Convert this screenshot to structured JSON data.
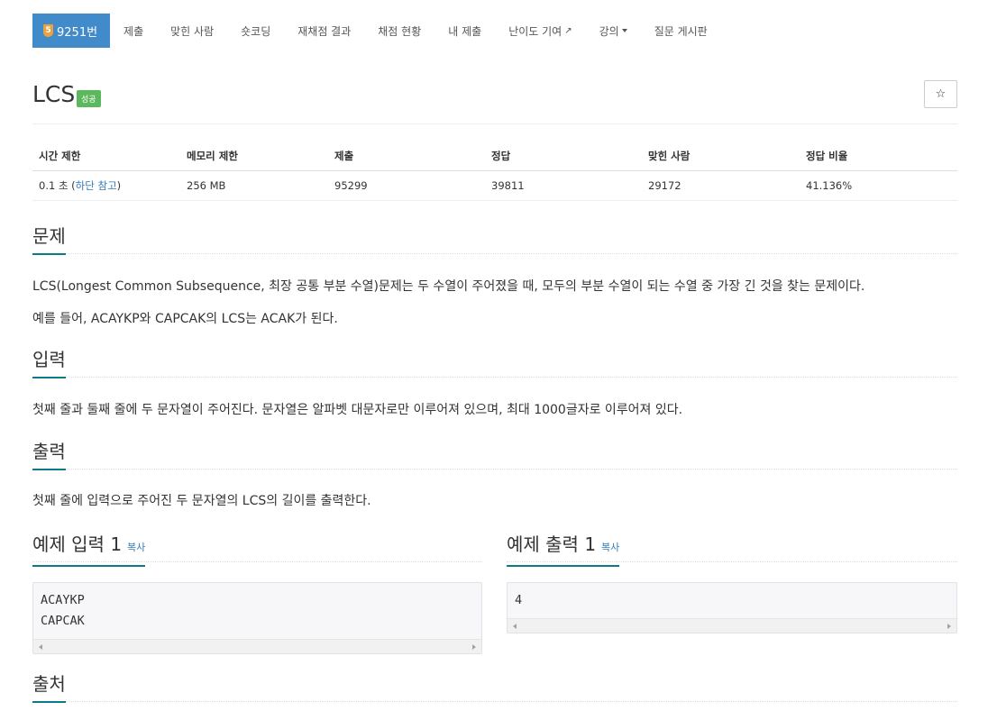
{
  "nav": {
    "problem_badge": "5",
    "problem_number": "9251번",
    "items": [
      "제출",
      "맞힌 사람",
      "숏코딩",
      "재채점 결과",
      "채점 현황",
      "내 제출",
      "난이도 기여",
      "강의",
      "질문 게시판"
    ]
  },
  "problem": {
    "title": "LCS",
    "status": "성공"
  },
  "info": {
    "headers": [
      "시간 제한",
      "메모리 제한",
      "제출",
      "정답",
      "맞힌 사람",
      "정답 비율"
    ],
    "time_limit_prefix": "0.1 초 (",
    "time_limit_link": "하단 참고",
    "time_limit_suffix": ")",
    "memory_limit": "256 MB",
    "submissions": "95299",
    "accepted": "39811",
    "solvers": "29172",
    "ratio": "41.136%"
  },
  "sections": {
    "description_title": "문제",
    "description_p1": "LCS(Longest Common Subsequence, 최장 공통 부분 수열)문제는 두 수열이 주어졌을 때, 모두의 부분 수열이 되는 수열 중 가장 긴 것을 찾는 문제이다.",
    "description_p2": "예를 들어, ACAYKP와 CAPCAK의 LCS는 ACAK가 된다.",
    "input_title": "입력",
    "input_text": "첫째 줄과 둘째 줄에 두 문자열이 주어진다. 문자열은 알파벳 대문자로만 이루어져 있으며, 최대 1000글자로 이루어져 있다.",
    "output_title": "출력",
    "output_text": "첫째 줄에 입력으로 주어진 두 문자열의 LCS의 길이를 출력한다.",
    "sample_input_title": "예제 입력 1",
    "sample_output_title": "예제 출력 1",
    "copy_label": "복사",
    "sample_input": "ACAYKP\nCAPCAK",
    "sample_output": "4",
    "source_title": "출처"
  },
  "colors": {
    "brand_blue": "#428bca",
    "success_green": "#5cb85c",
    "link_blue": "#337ab7",
    "heading_underline": "#0c7a88"
  }
}
